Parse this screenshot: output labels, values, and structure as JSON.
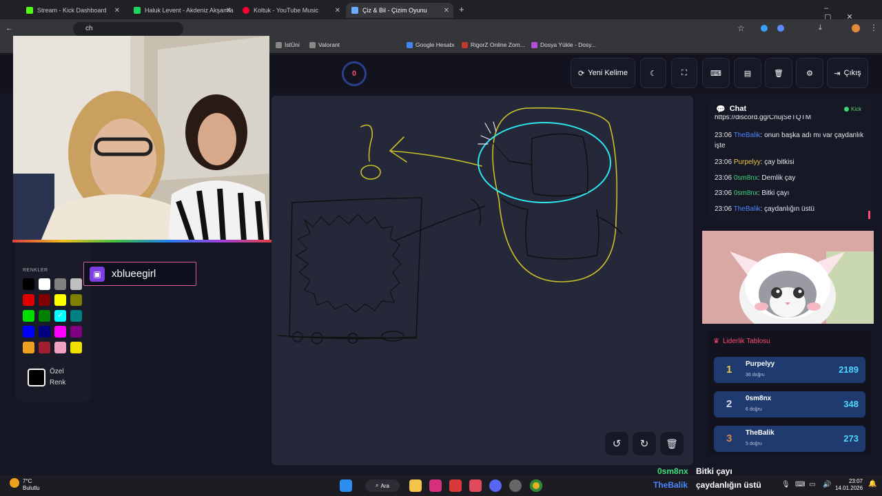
{
  "tabs": [
    {
      "label": "Stream - Kick Dashboard",
      "color": "#53fc18"
    },
    {
      "label": "Haluk Levent - Akdeniz Akşamla",
      "color": "#1ed760"
    },
    {
      "label": "Koltuk - YouTube Music",
      "color": "#ff0033"
    },
    {
      "label": "Çiz & Bil - Çizim Oyunu",
      "color": "#6fa8ff"
    }
  ],
  "address": {
    "text": "ch"
  },
  "bookmarks": [
    "İstÜni",
    "Valorant",
    "Google Hesabı",
    "RigorZ Online Zom...",
    "Dosya Yükle - Dosy..."
  ],
  "toolbar": {
    "timer": "0",
    "new_word": "Yeni Kelime",
    "exit": "Çıkış"
  },
  "palette": {
    "title": "RENKLER",
    "colors": [
      "#000000",
      "#ffffff",
      "#808080",
      "#c0c0c0",
      "#e00000",
      "#800000",
      "#ffff00",
      "#808000",
      "#00e000",
      "#008000",
      "#00ffff",
      "#008080",
      "#0000ff",
      "#000080",
      "#ff00ff",
      "#800080",
      "#f0a020",
      "#a02030",
      "#f0a0c0",
      "#f0e000"
    ],
    "custom_label_1": "Özel",
    "custom_label_2": "Renk"
  },
  "overlay_user": "xblueegirl",
  "chat": {
    "title": "Chat",
    "platform": "Kick",
    "top_line": "https://discord.gg/CnujSeTQTM",
    "messages": [
      {
        "time": "23:06",
        "user": "TheBalik",
        "text": ": onun başka adı mı var çaydanlık işte",
        "c": "u1"
      },
      {
        "time": "23:06",
        "user": "Purpelyy",
        "text": ": çay bitkisi",
        "c": "u2"
      },
      {
        "time": "23:06",
        "user": "0sm8nx",
        "text": ": Demlik çay",
        "c": "u3"
      },
      {
        "time": "23:06",
        "user": "0sm8nx",
        "text": ": Bitki çayı",
        "c": "u3"
      },
      {
        "time": "23:06",
        "user": "TheBalik",
        "text": ": çaydanlığın üstü",
        "c": "u1"
      }
    ]
  },
  "leaderboard": {
    "title": "Liderlik Tablosu",
    "rows": [
      {
        "rank": "1",
        "name": "Purpelyy",
        "sub": "36 doğru",
        "score": "2189",
        "rank_color": "#f4c542"
      },
      {
        "rank": "2",
        "name": "0sm8nx",
        "sub": "6 doğru",
        "score": "348",
        "rank_color": "#d8dce8"
      },
      {
        "rank": "3",
        "name": "TheBalik",
        "sub": "5 doğru",
        "score": "273",
        "rank_color": "#d0894a"
      }
    ]
  },
  "stream_overlay": [
    {
      "user": "0sm8nx",
      "text": "Bitki çayı"
    },
    {
      "user": "TheBalik",
      "text": "çaydanlığın üstü"
    }
  ],
  "taskbar": {
    "weather_temp": "7°C",
    "weather_desc": "Bulutlu",
    "search": "Ara",
    "time": "23:07",
    "date": "14.01.2026"
  }
}
